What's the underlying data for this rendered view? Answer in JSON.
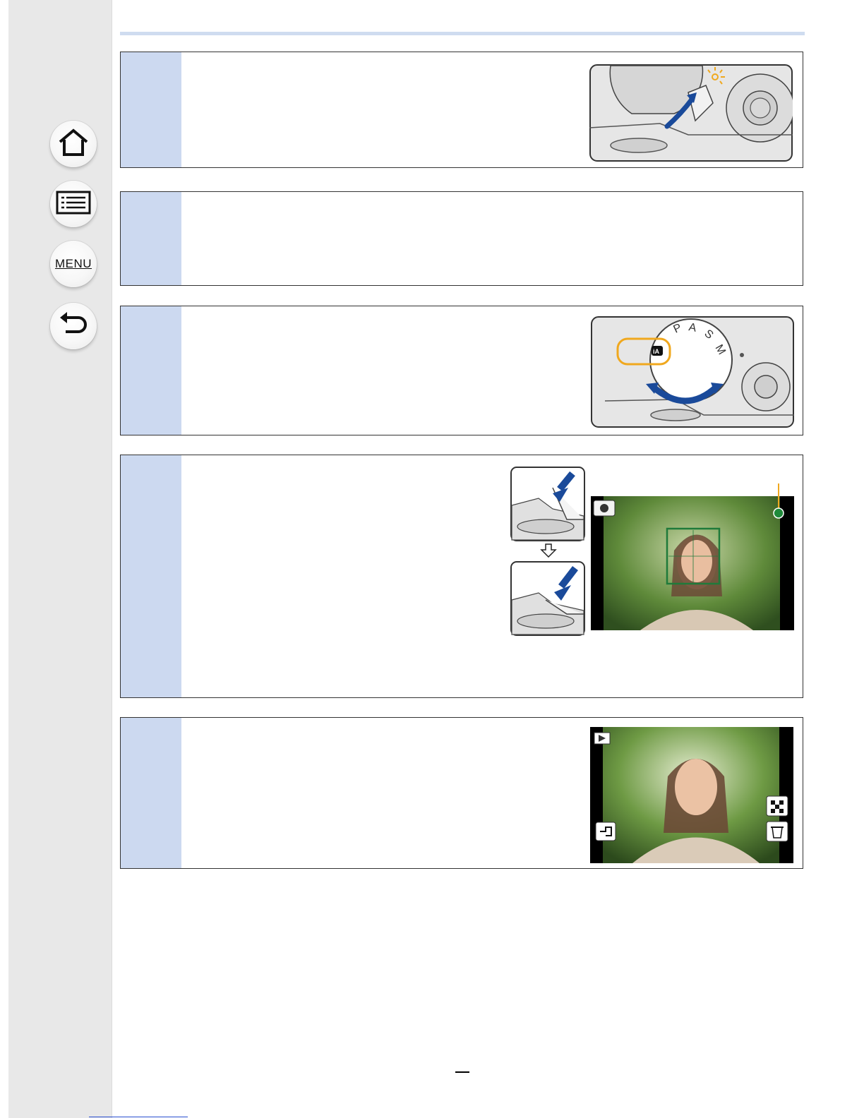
{
  "nav": {
    "home_icon": "home-icon",
    "contents_icon": "contents-list-icon",
    "menu_label": "MENU",
    "back_icon": "back-arrow-icon"
  },
  "steps": [
    {
      "id": 1,
      "num": "",
      "text": ""
    },
    {
      "id": 2,
      "num": "",
      "text": ""
    },
    {
      "id": 3,
      "num": "",
      "text": ""
    },
    {
      "id": 4,
      "num": "",
      "text": ""
    },
    {
      "id": 5,
      "num": "",
      "text": ""
    }
  ],
  "mode_dial": {
    "labels": [
      "P",
      "A",
      "S",
      "M",
      "iA"
    ]
  },
  "colors": {
    "sidebar": "#e8e8e8",
    "step_band": "#ccd9f0",
    "accent_orange": "#f0a81e",
    "arrow_blue": "#1a4a9a",
    "focus_green": "#1f7a3a"
  }
}
